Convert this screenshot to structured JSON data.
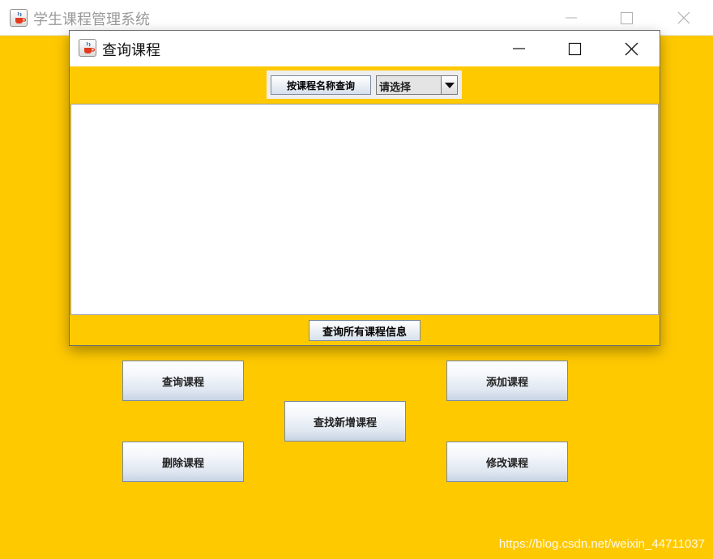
{
  "main_window": {
    "title": "学生课程管理系统",
    "buttons": {
      "query": "查询课程",
      "add": "添加课程",
      "find_new": "查找新增课程",
      "delete": "删除课程",
      "modify": "修改课程"
    }
  },
  "dialog": {
    "title": "查询课程",
    "search_button": "按课程名称查询",
    "select_value": "请选择",
    "query_all_button": "查询所有课程信息"
  },
  "watermark": "https://blog.csdn.net/weixin_44711037",
  "colors": {
    "background": "#ffc900",
    "table": "#ffffff"
  },
  "icons": [
    "java-cup-icon",
    "minimize-icon",
    "maximize-icon",
    "close-icon",
    "dropdown-arrow-icon"
  ]
}
